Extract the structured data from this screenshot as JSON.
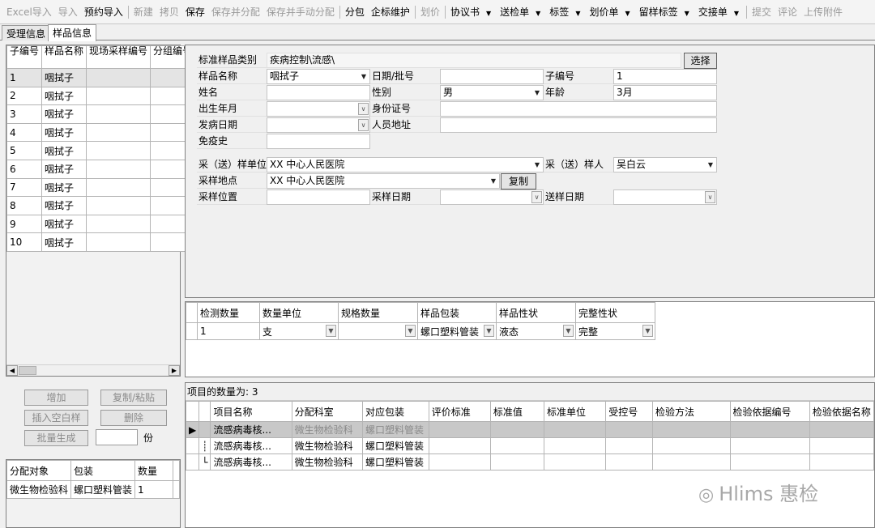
{
  "toolbar": {
    "excel_import": "Excel导入",
    "import": "导入",
    "reserve_import": "预约导入",
    "new": "新建",
    "copy": "拷贝",
    "save": "保存",
    "save_allocate": "保存并分配",
    "save_manual_allocate": "保存并手动分配",
    "subpackage": "分包",
    "standard_maintain": "企标维护",
    "price": "划价",
    "agreement": "协议书",
    "submission_form": "送检单",
    "label": "标签",
    "price_sheet": "划价单",
    "retain_label": "留样标签",
    "handover_sheet": "交接单",
    "submit": "提交",
    "comment": "评论",
    "upload": "上传附件"
  },
  "tabs": [
    "受理信息",
    "样品信息"
  ],
  "sample_list": {
    "headers": [
      "子编号",
      "样品名称",
      "现场采样编号",
      "分组编号"
    ],
    "rows": [
      [
        "1",
        "咽拭子",
        "",
        ""
      ],
      [
        "2",
        "咽拭子",
        "",
        ""
      ],
      [
        "3",
        "咽拭子",
        "",
        ""
      ],
      [
        "4",
        "咽拭子",
        "",
        ""
      ],
      [
        "5",
        "咽拭子",
        "",
        ""
      ],
      [
        "6",
        "咽拭子",
        "",
        ""
      ],
      [
        "7",
        "咽拭子",
        "",
        ""
      ],
      [
        "8",
        "咽拭子",
        "",
        ""
      ],
      [
        "9",
        "咽拭子",
        "",
        ""
      ],
      [
        "10",
        "咽拭子",
        "",
        ""
      ]
    ]
  },
  "left_buttons": {
    "add": "增加",
    "copy_paste": "复制/粘贴",
    "insert_blank": "插入空白样",
    "delete": "删除",
    "batch_generate": "批量生成",
    "unit": "份"
  },
  "allocation": {
    "headers": [
      "分配对象",
      "包装",
      "数量"
    ],
    "rows": [
      [
        "微生物检验科",
        "螺口塑料管装",
        "1"
      ]
    ]
  },
  "form": {
    "category_label": "标准样品类别",
    "category_value": "疾病控制\\流感\\",
    "select_btn": "选择",
    "sample_name_label": "样品名称",
    "sample_name_value": "咽拭子",
    "date_batch_label": "日期/批号",
    "date_batch_value": "",
    "sub_no_label": "子编号",
    "sub_no_value": "1",
    "name_label": "姓名",
    "name_value": "",
    "gender_label": "性别",
    "gender_value": "男",
    "age_label": "年龄",
    "age_value": "3月",
    "birth_label": "出生年月",
    "birth_value": "",
    "id_label": "身份证号",
    "id_value": "",
    "onset_label": "发病日期",
    "onset_value": "",
    "address_label": "人员地址",
    "address_value": "",
    "vaccine_label": "免疫史",
    "vaccine_value": "",
    "unit_label": "采（送）样单位",
    "unit_value": "XX 中心人民医院",
    "person_label": "采（送）样人",
    "person_value": "吴白云",
    "place_label": "采样地点",
    "place_value": "XX 中心人民医院",
    "copy_btn": "复制",
    "position_label": "采样位置",
    "position_value": "",
    "sample_date_label": "采样日期",
    "sample_date_value": "",
    "send_date_label": "送样日期",
    "send_date_value": ""
  },
  "quantity": {
    "headers": [
      "检测数量",
      "数量单位",
      "规格数量",
      "样品包装",
      "样品性状",
      "完整性状"
    ],
    "row": [
      "1",
      "支",
      "",
      "螺口塑料管装",
      "液态",
      "完整"
    ]
  },
  "items": {
    "count_label": "项目的数量为: 3",
    "headers": [
      "项目名称",
      "分配科室",
      "对应包装",
      "评价标准",
      "标准值",
      "标准单位",
      "受控号",
      "检验方法",
      "检验依据编号",
      "检验依据名称"
    ],
    "rows": [
      [
        "流感病毒核...",
        "微生物检验科",
        "螺口塑料管装",
        "",
        "",
        "",
        "",
        "",
        "",
        ""
      ],
      [
        "流感病毒核...",
        "微生物检验科",
        "螺口塑料管装",
        "",
        "",
        "",
        "",
        "",
        "",
        ""
      ],
      [
        "流感病毒核...",
        "微生物检验科",
        "螺口塑料管装",
        "",
        "",
        "",
        "",
        "",
        "",
        ""
      ]
    ]
  },
  "watermark": "Hlims 惠检"
}
